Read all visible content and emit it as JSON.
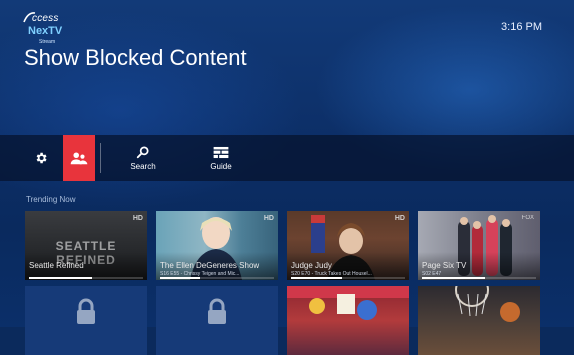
{
  "header": {
    "logo": {
      "line1": "ccess",
      "line2": "NexTV",
      "line3": "Stream"
    },
    "clock": "3:16 PM",
    "title": "Show Blocked Content"
  },
  "nav": {
    "settings": {
      "icon": "gear-icon"
    },
    "blocked": {
      "icon": "users-icon",
      "accent": "#e8343c"
    },
    "search": {
      "label": "Search",
      "icon": "search-icon"
    },
    "guide": {
      "label": "Guide",
      "icon": "grid-icon"
    }
  },
  "trending": {
    "title": "Trending Now",
    "tiles": [
      {
        "title": "Seattle Refined",
        "subtitle": "",
        "badge": "HD",
        "art_text": "SEATTLE REFINED",
        "progress": 0.55
      },
      {
        "title": "The Ellen DeGeneres Show",
        "subtitle": "S16 E55 - Chrissy Teigen and Mic...",
        "badge": "HD",
        "progress": 0.35
      },
      {
        "title": "Judge Judy",
        "subtitle": "S20 E70 - Truck Takes Out Housel...",
        "badge": "HD",
        "progress": 0.45
      },
      {
        "title": "Page Six TV",
        "subtitle": "S02 E47",
        "badge": "FOX",
        "progress": 0.55
      },
      {
        "title": "",
        "subtitle": "",
        "locked": true
      },
      {
        "title": "",
        "subtitle": "",
        "locked": true
      },
      {
        "title": "",
        "subtitle": ""
      },
      {
        "title": "",
        "subtitle": ""
      }
    ]
  }
}
